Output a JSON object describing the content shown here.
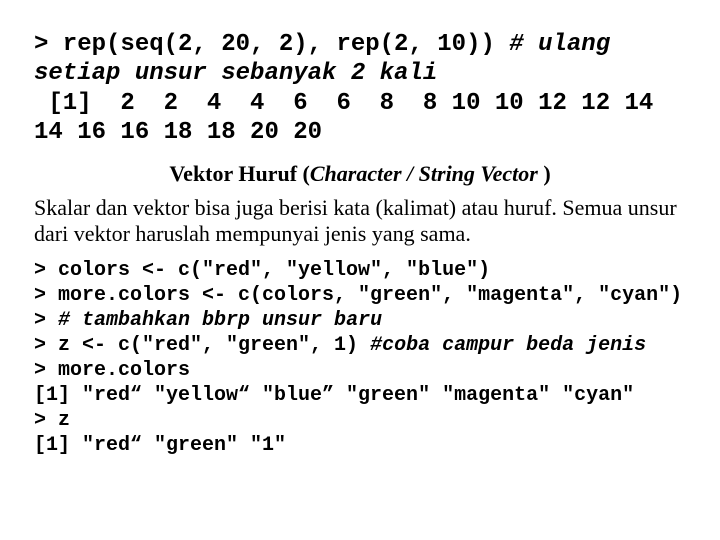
{
  "block1": {
    "cmd_a": "> rep(seq(2, 20, 2), rep(2, 10)) ",
    "cmd_b": "# ulang setiap unsur sebanyak 2 kali",
    "out1": " [1]  2  2  4  4  6  6  8  8 10 10 12 12 14 14 16 16 18 18 20 20"
  },
  "heading": {
    "a": "Vektor Huruf (",
    "b": "Character  / String Vector ",
    "c": ")"
  },
  "para": "Skalar dan vektor bisa  juga berisi kata (kalimat) atau huruf. Semua unsur dari vektor haruslah mempunyai jenis yang sama.",
  "block2": {
    "l1": "> colors <- c(\"red\", \"yellow\", \"blue\")",
    "l2": "> more.colors <- c(colors, \"green\", \"magenta\", \"cyan\")",
    "l3a": "> ",
    "l3b": "# tambahkan bbrp unsur baru",
    "l4a": "> z <- c(\"red\", \"green\", 1) ",
    "l4b": "#coba campur beda jenis",
    "l5": "> more.colors",
    "l6": "[1] \"red“ \"yellow“ \"blue” \"green\" \"magenta\" \"cyan\"",
    "l7": "> z",
    "l8": "[1] \"red“ \"green\" \"1\""
  }
}
